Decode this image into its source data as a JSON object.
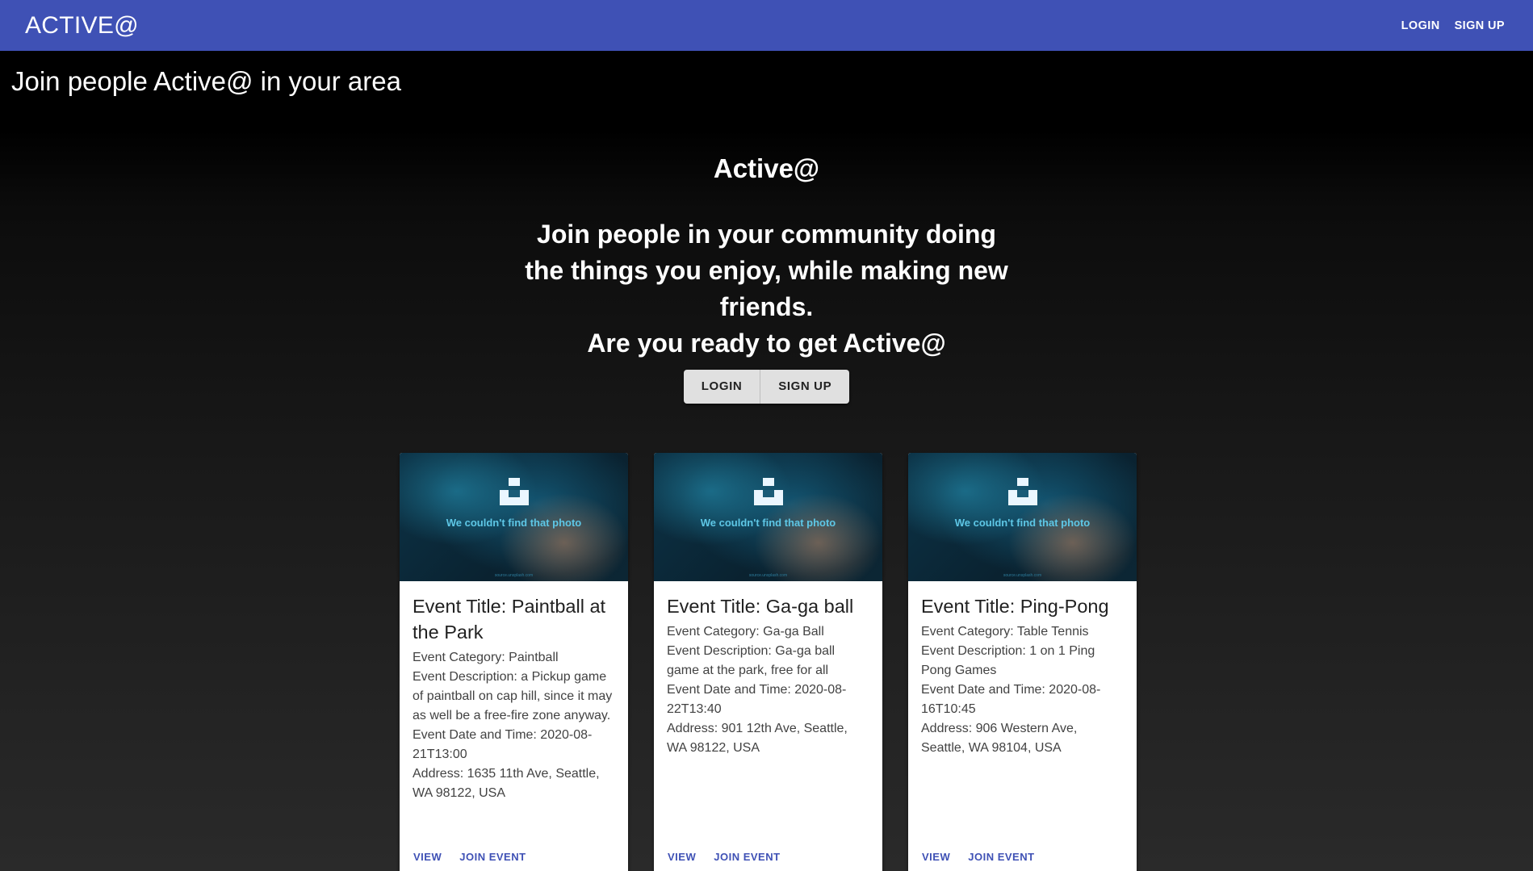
{
  "appbar": {
    "brand": "ACTIVE@",
    "login_label": "LOGIN",
    "signup_label": "SIGN UP",
    "color": "#3f51b5"
  },
  "banner": {
    "title": "Join people Active@ in your area"
  },
  "hero": {
    "brand": "Active@",
    "tagline": "Join people in your community doing the things you enjoy, while making new friends.",
    "cta": "Are you ready to get Active@",
    "login_label": "LOGIN",
    "signup_label": "SIGN UP"
  },
  "placeholder_image": {
    "text": "We couldn't find that photo",
    "sub": "source.unsplash.com"
  },
  "events": [
    {
      "title": "Event Title: Paintball at the Park",
      "category": "Event Category: Paintball",
      "description": "Event Description: a Pickup game of paintball on cap hill, since it may as well be a free-fire zone anyway.",
      "datetime": "Event Date and Time: 2020-08-21T13:00",
      "address": "Address: 1635 11th Ave, Seattle, WA 98122, USA",
      "view_label": "VIEW",
      "join_label": "JOIN EVENT"
    },
    {
      "title": "Event Title: Ga-ga ball",
      "category": "Event Category: Ga-ga Ball",
      "description": "Event Description: Ga-ga ball game at the park, free for all",
      "datetime": "Event Date and Time: 2020-08-22T13:40",
      "address": "Address: 901 12th Ave, Seattle, WA 98122, USA",
      "view_label": "VIEW",
      "join_label": "JOIN EVENT"
    },
    {
      "title": "Event Title: Ping-Pong",
      "category": "Event Category: Table Tennis",
      "description": "Event Description: 1 on 1 Ping Pong Games",
      "datetime": "Event Date and Time: 2020-08-16T10:45",
      "address": "Address: 906 Western Ave, Seattle, WA 98104, USA",
      "view_label": "VIEW",
      "join_label": "JOIN EVENT"
    }
  ]
}
